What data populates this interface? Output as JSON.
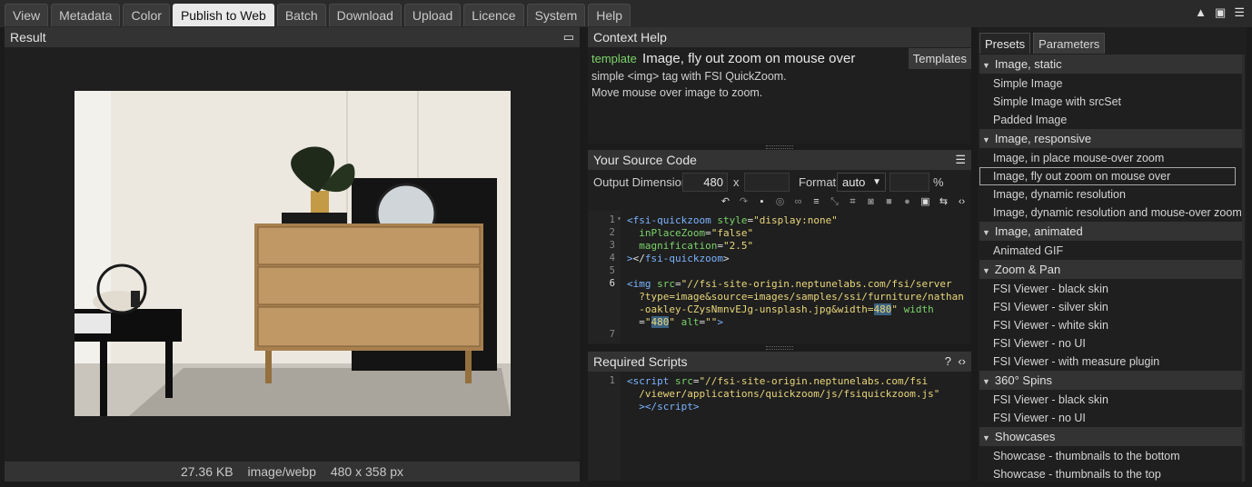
{
  "tabs": [
    "View",
    "Metadata",
    "Color",
    "Publish to Web",
    "Batch",
    "Download",
    "Upload",
    "Licence",
    "System",
    "Help"
  ],
  "active_tab": "Publish to Web",
  "result": {
    "title": "Result",
    "status": {
      "size": "27.36 KB",
      "type": "image/webp",
      "dims": "480 x 358 px"
    }
  },
  "context_help": {
    "title": "Context Help",
    "keyword": "template",
    "template_name": "Image, fly out zoom on mouse over",
    "templates_button": "Templates",
    "desc1": "simple <img> tag with FSI QuickZoom.",
    "desc2": "Move mouse over image to zoom."
  },
  "source_code": {
    "title": "Your Source Code",
    "output_label": "Output Dimension",
    "width_value": "480",
    "times": "x",
    "height_value": "",
    "format_label": "Format",
    "format_value": "auto",
    "percent_value": "",
    "percent_sign": "%",
    "lines": [
      {
        "n": "1",
        "fold": "▾",
        "segs": [
          [
            "tg",
            "<fsi-quickzoom "
          ],
          [
            "at",
            "style"
          ],
          [
            "pl",
            "="
          ],
          [
            "st",
            "\"display:none\""
          ]
        ]
      },
      {
        "n": "2",
        "fold": "",
        "segs": [
          [
            "pl",
            "  "
          ],
          [
            "at",
            "inPlaceZoom"
          ],
          [
            "pl",
            "="
          ],
          [
            "st",
            "\"false\""
          ]
        ]
      },
      {
        "n": "3",
        "fold": "",
        "segs": [
          [
            "pl",
            "  "
          ],
          [
            "at",
            "magnification"
          ],
          [
            "pl",
            "="
          ],
          [
            "st",
            "\"2.5\""
          ]
        ]
      },
      {
        "n": "4",
        "fold": "",
        "segs": [
          [
            "tg",
            ">"
          ],
          [
            "pl",
            "</"
          ],
          [
            "tg",
            "fsi-quickzoom"
          ],
          [
            "pl",
            ">"
          ]
        ]
      },
      {
        "n": "5",
        "fold": "",
        "segs": []
      },
      {
        "n": "6",
        "fold": "",
        "segs": [
          [
            "tg",
            "<img "
          ],
          [
            "at",
            "src"
          ],
          [
            "pl",
            "="
          ],
          [
            "st",
            "\"//fsi-site-origin.neptunelabs.com/fsi/server"
          ]
        ]
      },
      {
        "n": "",
        "fold": "",
        "segs": [
          [
            "st",
            "  ?type=image&source=images/samples/ssi/furniture/nathan"
          ]
        ]
      },
      {
        "n": "",
        "fold": "",
        "segs": [
          [
            "st",
            "  -oakley-CZysNmnvEJg-unsplash.jpg&width="
          ],
          [
            "hl",
            "480"
          ],
          [
            "st",
            "\""
          ],
          [
            "pl",
            " "
          ],
          [
            "at",
            "width"
          ]
        ]
      },
      {
        "n": "",
        "fold": "",
        "segs": [
          [
            "pl",
            "  ="
          ],
          [
            "st",
            "\""
          ],
          [
            "hl",
            "480"
          ],
          [
            "st",
            "\""
          ],
          [
            "pl",
            " "
          ],
          [
            "at",
            "alt"
          ],
          [
            "pl",
            "="
          ],
          [
            "st",
            "\"\""
          ],
          [
            "tg",
            ">"
          ]
        ]
      },
      {
        "n": "7",
        "fold": "",
        "segs": []
      }
    ]
  },
  "required_scripts": {
    "title": "Required Scripts",
    "help": "?",
    "lines": [
      {
        "n": "1",
        "segs": [
          [
            "tg",
            "<script "
          ],
          [
            "at",
            "src"
          ],
          [
            "pl",
            "="
          ],
          [
            "st",
            "\"//fsi-site-origin.neptunelabs.com/fsi"
          ]
        ]
      },
      {
        "n": "",
        "segs": [
          [
            "st",
            "  /viewer/applications/quickzoom/js/fsiquickzoom.js\""
          ]
        ]
      },
      {
        "n": "",
        "segs": [
          [
            "tg",
            "  ></"
          ],
          [
            "tg",
            "script"
          ],
          [
            "tg",
            ">"
          ]
        ]
      }
    ]
  },
  "presets": {
    "tabs": [
      "Presets",
      "Parameters"
    ],
    "active_tab": "Presets",
    "selected": "Image, fly out zoom on mouse over",
    "groups": [
      {
        "name": "Image, static",
        "items": [
          "Simple Image",
          "Simple Image with srcSet",
          "Padded Image"
        ]
      },
      {
        "name": "Image, responsive",
        "items": [
          "Image, in place mouse-over zoom",
          "Image, fly out zoom on mouse over",
          "Image, dynamic resolution",
          "Image, dynamic resolution and mouse-over zoom"
        ]
      },
      {
        "name": "Image, animated",
        "items": [
          "Animated GIF"
        ]
      },
      {
        "name": "Zoom & Pan",
        "items": [
          "FSI Viewer - black skin",
          "FSI Viewer - silver skin",
          "FSI Viewer - white skin",
          "FSI Viewer - no UI",
          "FSI Viewer - with measure plugin"
        ]
      },
      {
        "name": "360° Spins",
        "items": [
          "FSI Viewer - black skin",
          "FSI Viewer - no UI"
        ]
      },
      {
        "name": "Showcases",
        "items": [
          "Showcase - thumbnails to the bottom",
          "Showcase - thumbnails to the top"
        ]
      }
    ]
  },
  "accent": "#7bd36a"
}
